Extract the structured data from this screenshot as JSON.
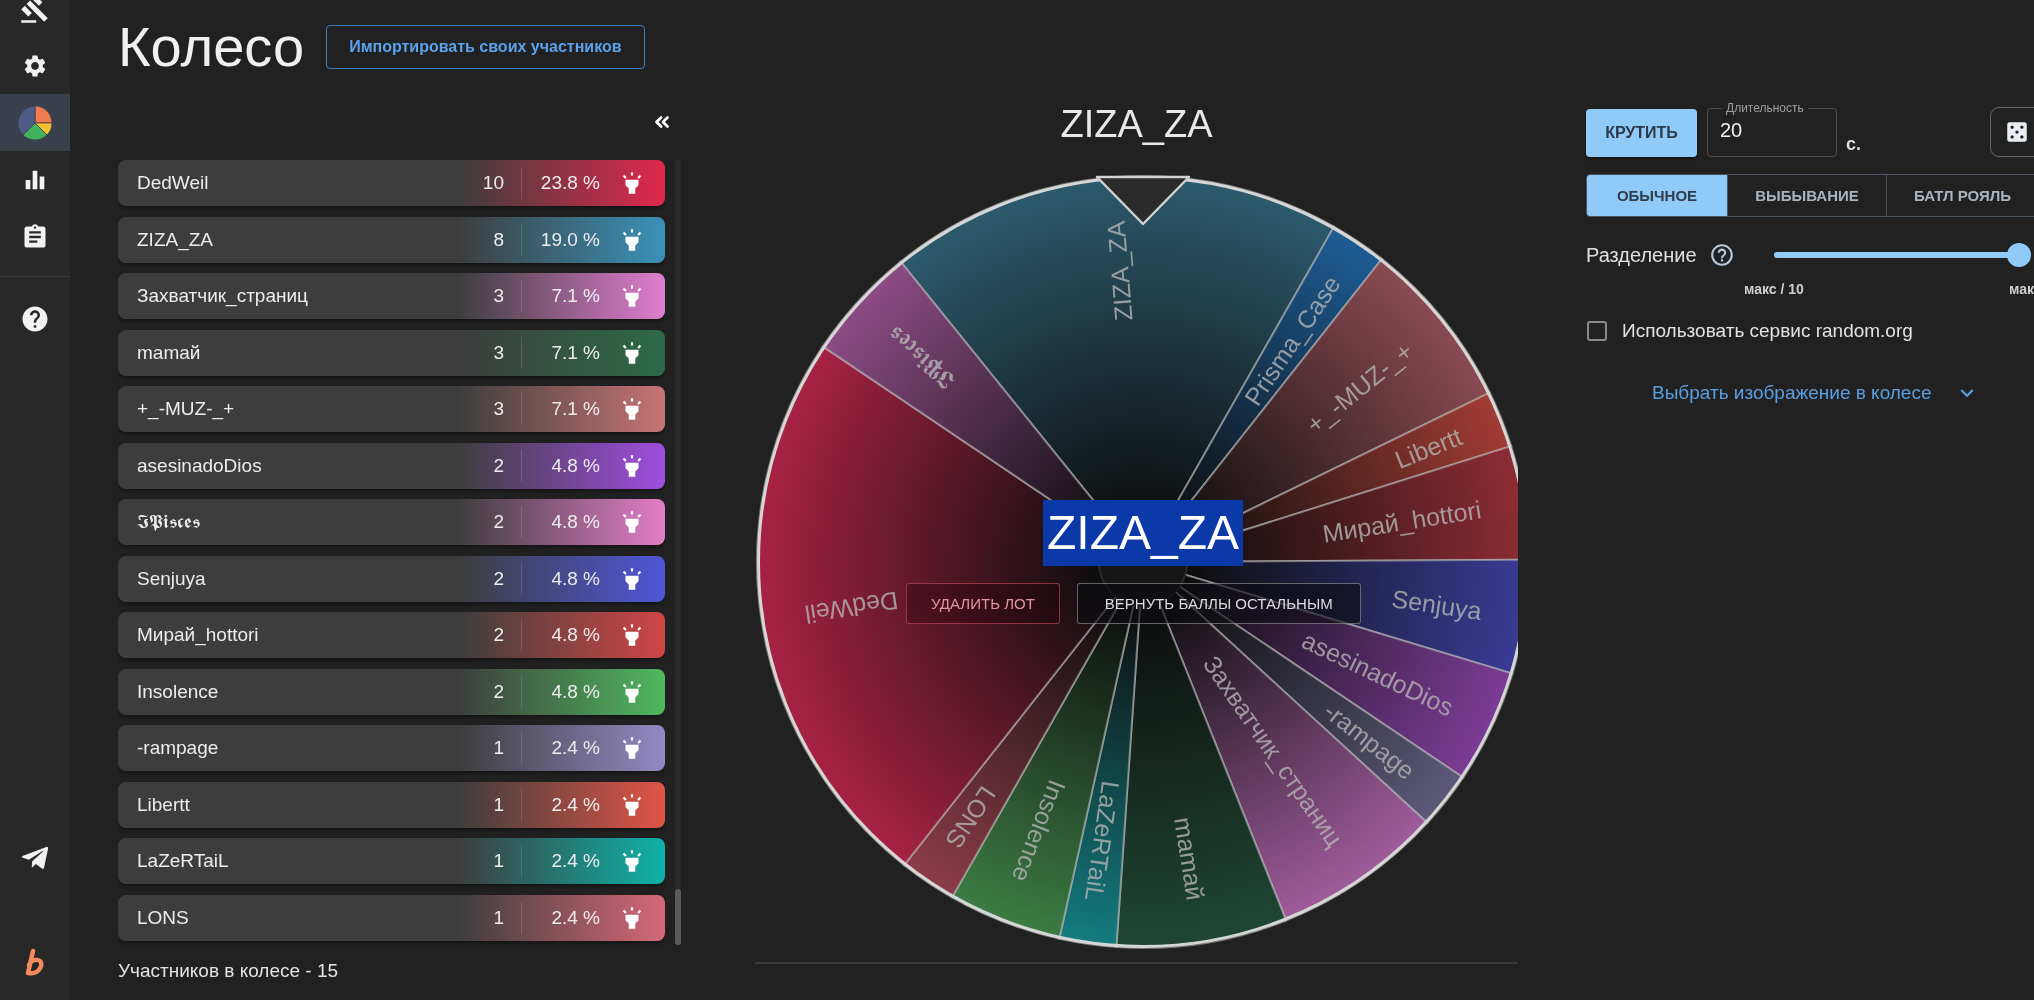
{
  "sidebar": {
    "items": [
      {
        "selected": false
      },
      {
        "selected": false
      },
      {
        "selected": true
      },
      {
        "selected": false
      },
      {
        "selected": false
      },
      {
        "selected": false
      }
    ]
  },
  "header": {
    "title": "Колесо",
    "import_button": "Импортировать своих участников"
  },
  "participants": {
    "rows": [
      {
        "name": "DedWeil",
        "points": "10",
        "percent": "23.8 %",
        "color": "#e0284c"
      },
      {
        "name": "ZIZA_ZA",
        "points": "8",
        "percent": "19.0 %",
        "color": "#3a92b8"
      },
      {
        "name": "Захватчик_страниц",
        "points": "3",
        "percent": "7.1 %",
        "color": "#e07ed0"
      },
      {
        "name": "mamaй",
        "points": "3",
        "percent": "7.1 %",
        "color": "#2d6a48"
      },
      {
        "name": "+_-MUZ-_+",
        "points": "3",
        "percent": "7.1 %",
        "color": "#c87474"
      },
      {
        "name": "asesinadoDios",
        "points": "2",
        "percent": "4.8 %",
        "color": "#a04ee0"
      },
      {
        "name": "𝕴𝕻𝖎𝖘𝖈𝖊𝖘",
        "points": "2",
        "percent": "4.8 %",
        "color": "#e37ec8"
      },
      {
        "name": "Senjuya",
        "points": "2",
        "percent": "4.8 %",
        "color": "#4f56d8"
      },
      {
        "name": "Мирай_hottori",
        "points": "2",
        "percent": "4.8 %",
        "color": "#d04646"
      },
      {
        "name": "Insolence",
        "points": "2",
        "percent": "4.8 %",
        "color": "#4fb85e"
      },
      {
        "name": "-rampage",
        "points": "1",
        "percent": "2.4 %",
        "color": "#928ac4"
      },
      {
        "name": "Libertt",
        "points": "1",
        "percent": "2.4 %",
        "color": "#e05446"
      },
      {
        "name": "LaZeRTaiL",
        "points": "1",
        "percent": "2.4 %",
        "color": "#0eb2a8"
      },
      {
        "name": "LONS",
        "points": "1",
        "percent": "2.4 %",
        "color": "#d66878"
      }
    ],
    "count_text": "Участников в колесе - 15"
  },
  "wheel": {
    "title": "ZIZA_ZA",
    "slices": [
      {
        "label": "ZIZA_ZA",
        "color": "#2c5a6c"
      },
      {
        "label": "Prisma_Case",
        "color": "#1d5c94"
      },
      {
        "label": "+_-MUZ-_+",
        "color": "#8a4a52"
      },
      {
        "label": "Libertt",
        "color": "#a23c34"
      },
      {
        "label": "Мирай_hottori",
        "color": "#8e2c34"
      },
      {
        "label": "Senjuya",
        "color": "#3a3c96"
      },
      {
        "label": "asesinadoDios",
        "color": "#7c3c96"
      },
      {
        "label": "-rampage",
        "color": "#5c5a78"
      },
      {
        "label": "Захватчик_страниц",
        "color": "#a05c9c"
      },
      {
        "label": "mamaй",
        "color": "#1f4634"
      },
      {
        "label": "LaZeRTaiL",
        "color": "#147c80"
      },
      {
        "label": "Insolence",
        "color": "#3c7c44"
      },
      {
        "label": "LONS",
        "color": "#8c3c4a"
      },
      {
        "label": "DedWeil",
        "color": "#a82244"
      },
      {
        "label": "𝕴𝕻𝖎𝖘𝖈𝖊𝖘",
        "color": "#8c4c84"
      }
    ],
    "winner": "ZIZA_ZA",
    "delete_button": "УДАЛИТЬ ЛОТ",
    "return_button": "ВЕРНУТЬ БАЛЛЫ ОСТАЛЬНЫМ"
  },
  "controls": {
    "spin_button": "КРУТИТЬ",
    "duration": {
      "label": "Длительность",
      "value": "20",
      "unit": "с."
    },
    "modes": [
      {
        "label": "ОБЫЧНОЕ",
        "selected": true
      },
      {
        "label": "ВЫБЫВАНИЕ",
        "selected": false
      },
      {
        "label": "БАТЛ РОЯЛЬ",
        "selected": false
      }
    ],
    "split": {
      "label": "Разделение",
      "level": 1,
      "min_label": "макс / 10",
      "max_label": "мак"
    },
    "random_org": {
      "label": "Использовать сервис random.org",
      "checked": false
    },
    "image_link": "Выбрать изображение в колесе"
  }
}
